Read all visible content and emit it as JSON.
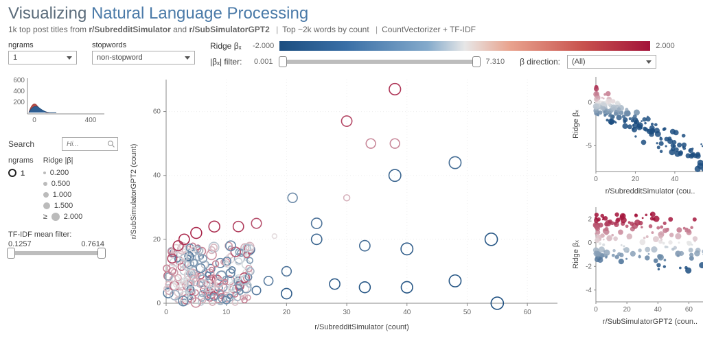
{
  "header": {
    "title_a": "Visualizing",
    "title_b": "Natural Language Processing",
    "subtitle_prefix": "1k top post titles from ",
    "subreddit_a": "r/SubredditSimulator",
    "subtitle_mid1": " and ",
    "subreddit_b": "r/SubSimulatorGPT2",
    "subtitle_words": "Top ~2k words by count",
    "subtitle_method": "CountVectorizer + TF-IDF"
  },
  "controls": {
    "ngrams_label": "ngrams",
    "ngrams_value": "1",
    "stopwords_label": "stopwords",
    "stopwords_value": "non-stopword",
    "ridgebx_label": "Ridge βₓ",
    "ridge_min": "-2.000",
    "ridge_max": "2.000",
    "absbeta_label": "|βₓ| filter:",
    "absbeta_min": "0.001",
    "absbeta_max": "7.310",
    "beta_dir_label": "β direction:",
    "beta_dir_value": "(All)"
  },
  "left": {
    "mini_y_ticks": [
      "600",
      "400",
      "200"
    ],
    "mini_x_ticks": [
      "0",
      "400"
    ],
    "search_label": "Search",
    "search_placeholder": "Hi...",
    "legend_ngrams_hdr": "ngrams",
    "legend_ngrams_val": "1",
    "legend_ridge_hdr": "Ridge |β|",
    "legend_sizes": [
      "0.200",
      "0.500",
      "1.000",
      "1.500",
      "2.000"
    ],
    "legend_ge": "≥",
    "tfidf_label": "TF-IDF mean filter:",
    "tfidf_min": "0.1257",
    "tfidf_max": "0.7614"
  },
  "main_chart": {
    "xlabel": "r/SubredditSimulator (count)",
    "ylabel": "r/SubSimulatorGPT2 (count)",
    "x_ticks": [
      "0",
      "10",
      "20",
      "30",
      "40",
      "50",
      "60"
    ],
    "y_ticks": [
      "0",
      "20",
      "40",
      "60"
    ]
  },
  "right1": {
    "ylabel": "Ridge βₓ",
    "xlabel": "r/SubredditSimulator (cou..",
    "y_ticks": [
      "0",
      "-5"
    ],
    "x_ticks": [
      "0",
      "20",
      "40"
    ]
  },
  "right2": {
    "ylabel": "Ridge βₓ",
    "xlabel": "r/SubSimulatorGPT2 (coun..",
    "y_ticks": [
      "2",
      "0",
      "-2",
      "-4"
    ],
    "x_ticks": [
      "0",
      "20",
      "40",
      "60"
    ]
  },
  "chart_data": [
    {
      "type": "scatter",
      "name": "main",
      "xlabel": "r/SubredditSimulator (count)",
      "ylabel": "r/SubSimulatorGPT2 (count)",
      "xlim": [
        0,
        65
      ],
      "ylim": [
        0,
        70
      ],
      "series": [
        {
          "name": "ngrams=1 (color=Ridge βₓ, size=|β|)",
          "points": [
            {
              "x": 38,
              "y": 67,
              "beta": 1.7,
              "abs": 1.8
            },
            {
              "x": 30,
              "y": 57,
              "beta": 1.5,
              "abs": 1.6
            },
            {
              "x": 34,
              "y": 50,
              "beta": 0.9,
              "abs": 1.4
            },
            {
              "x": 38,
              "y": 50,
              "beta": 0.9,
              "abs": 1.4
            },
            {
              "x": 48,
              "y": 44,
              "beta": -1.6,
              "abs": 1.9
            },
            {
              "x": 38,
              "y": 40,
              "beta": -1.7,
              "abs": 1.9
            },
            {
              "x": 30,
              "y": 33,
              "beta": 0.5,
              "abs": 0.7
            },
            {
              "x": 21,
              "y": 33,
              "beta": -1.2,
              "abs": 1.4
            },
            {
              "x": 25,
              "y": 25,
              "beta": -1.5,
              "abs": 1.6
            },
            {
              "x": 25,
              "y": 20,
              "beta": -1.7,
              "abs": 1.6
            },
            {
              "x": 33,
              "y": 18,
              "beta": -1.6,
              "abs": 1.6
            },
            {
              "x": 40,
              "y": 17,
              "beta": -1.8,
              "abs": 1.9
            },
            {
              "x": 54,
              "y": 20,
              "beta": -1.9,
              "abs": 2.0
            },
            {
              "x": 55,
              "y": 0,
              "beta": -2.0,
              "abs": 2.0
            },
            {
              "x": 48,
              "y": 7,
              "beta": -1.9,
              "abs": 1.9
            },
            {
              "x": 40,
              "y": 5,
              "beta": -1.9,
              "abs": 1.8
            },
            {
              "x": 33,
              "y": 5,
              "beta": -1.9,
              "abs": 1.7
            },
            {
              "x": 28,
              "y": 6,
              "beta": -1.8,
              "abs": 1.6
            },
            {
              "x": 20,
              "y": 3,
              "beta": -1.8,
              "abs": 1.6
            },
            {
              "x": 18,
              "y": 21,
              "beta": 0.1,
              "abs": 0.4
            },
            {
              "x": 15,
              "y": 25,
              "beta": 1.4,
              "abs": 1.5
            },
            {
              "x": 12,
              "y": 24,
              "beta": 1.6,
              "abs": 1.6
            },
            {
              "x": 8,
              "y": 24,
              "beta": 1.7,
              "abs": 1.7
            },
            {
              "x": 5,
              "y": 22,
              "beta": 1.8,
              "abs": 1.7
            },
            {
              "x": 3,
              "y": 20,
              "beta": 1.8,
              "abs": 1.6
            },
            {
              "x": 2,
              "y": 18,
              "beta": 1.7,
              "abs": 1.5
            },
            {
              "x": 1,
              "y": 14,
              "beta": 1.5,
              "abs": 1.3
            },
            {
              "x": 1,
              "y": 10,
              "beta": 1.0,
              "abs": 0.9
            },
            {
              "x": 2,
              "y": 8,
              "beta": 0.6,
              "abs": 0.7
            },
            {
              "x": 3,
              "y": 6,
              "beta": 0.2,
              "abs": 0.5
            },
            {
              "x": 4,
              "y": 4,
              "beta": -0.4,
              "abs": 0.5
            },
            {
              "x": 6,
              "y": 3,
              "beta": -0.8,
              "abs": 0.7
            },
            {
              "x": 8,
              "y": 2,
              "beta": -1.1,
              "abs": 0.9
            },
            {
              "x": 10,
              "y": 1,
              "beta": -1.3,
              "abs": 1.0
            },
            {
              "x": 12,
              "y": 8,
              "beta": -0.2,
              "abs": 0.6
            },
            {
              "x": 14,
              "y": 10,
              "beta": -0.7,
              "abs": 0.9
            },
            {
              "x": 15,
              "y": 4,
              "beta": -1.5,
              "abs": 1.2
            },
            {
              "x": 17,
              "y": 7,
              "beta": -1.4,
              "abs": 1.3
            },
            {
              "x": 20,
              "y": 10,
              "beta": -1.5,
              "abs": 1.4
            }
          ]
        }
      ]
    },
    {
      "type": "scatter",
      "name": "right_top",
      "xlabel": "r/SubredditSimulator (count)",
      "ylabel": "Ridge βₓ",
      "xlim": [
        0,
        55
      ],
      "ylim": [
        -8,
        3
      ]
    },
    {
      "type": "scatter",
      "name": "right_bottom",
      "xlabel": "r/SubSimulatorGPT2 (count)",
      "ylabel": "Ridge βₓ",
      "xlim": [
        0,
        70
      ],
      "ylim": [
        -5,
        3
      ]
    }
  ]
}
